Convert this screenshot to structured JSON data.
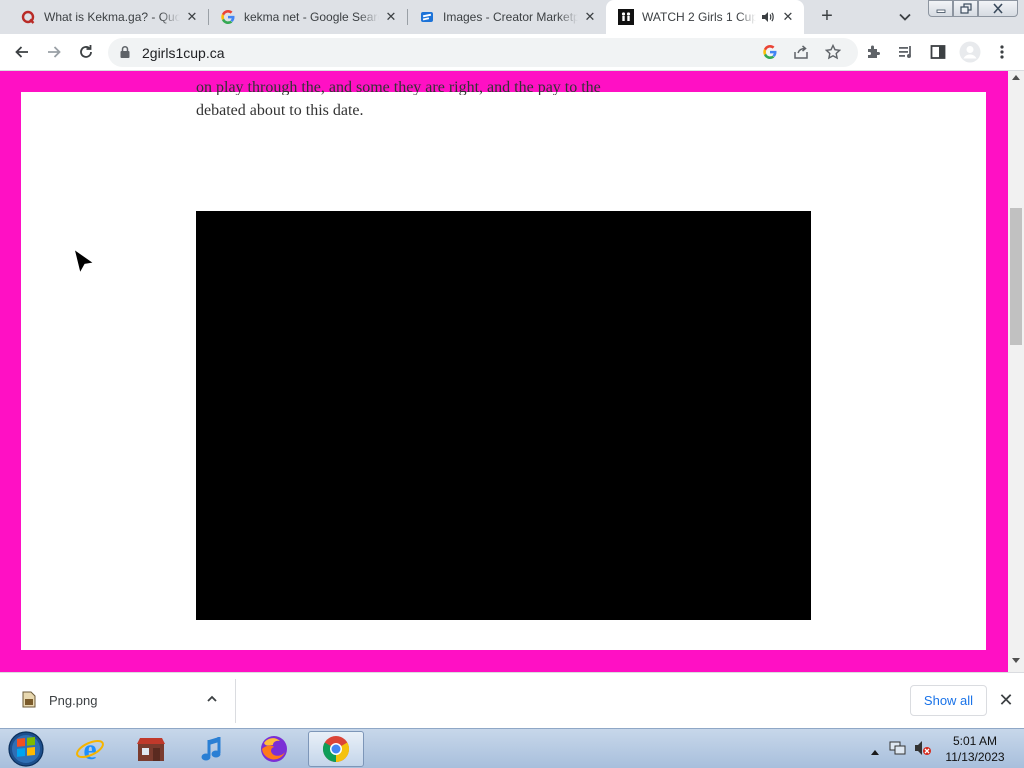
{
  "browser": {
    "tabs": [
      {
        "title": "What is Kekma.ga? - Quora",
        "favicon": "quora-icon",
        "active": false
      },
      {
        "title": "kekma net - Google Search",
        "favicon": "google-icon",
        "active": false
      },
      {
        "title": "Images - Creator Marketplace",
        "favicon": "roblox-icon",
        "active": false
      },
      {
        "title": "WATCH 2 Girls 1 Cup",
        "favicon": "site-icon",
        "active": true,
        "audio": true
      }
    ],
    "url": "2girls1cup.ca"
  },
  "page": {
    "cut_text": "on play through the, and some they are right, and the pay to the",
    "paragraph": "debated about to this date.",
    "border_color": "#ff10c4",
    "video": "black video player"
  },
  "downloads": {
    "file_name": "Png.png",
    "show_all_label": "Show all"
  },
  "taskbar": {
    "apps": [
      "start-orb",
      "internet-explorer",
      "store-app",
      "itunes",
      "firefox",
      "chrome"
    ],
    "time": "5:01 AM",
    "date": "11/13/2023"
  }
}
